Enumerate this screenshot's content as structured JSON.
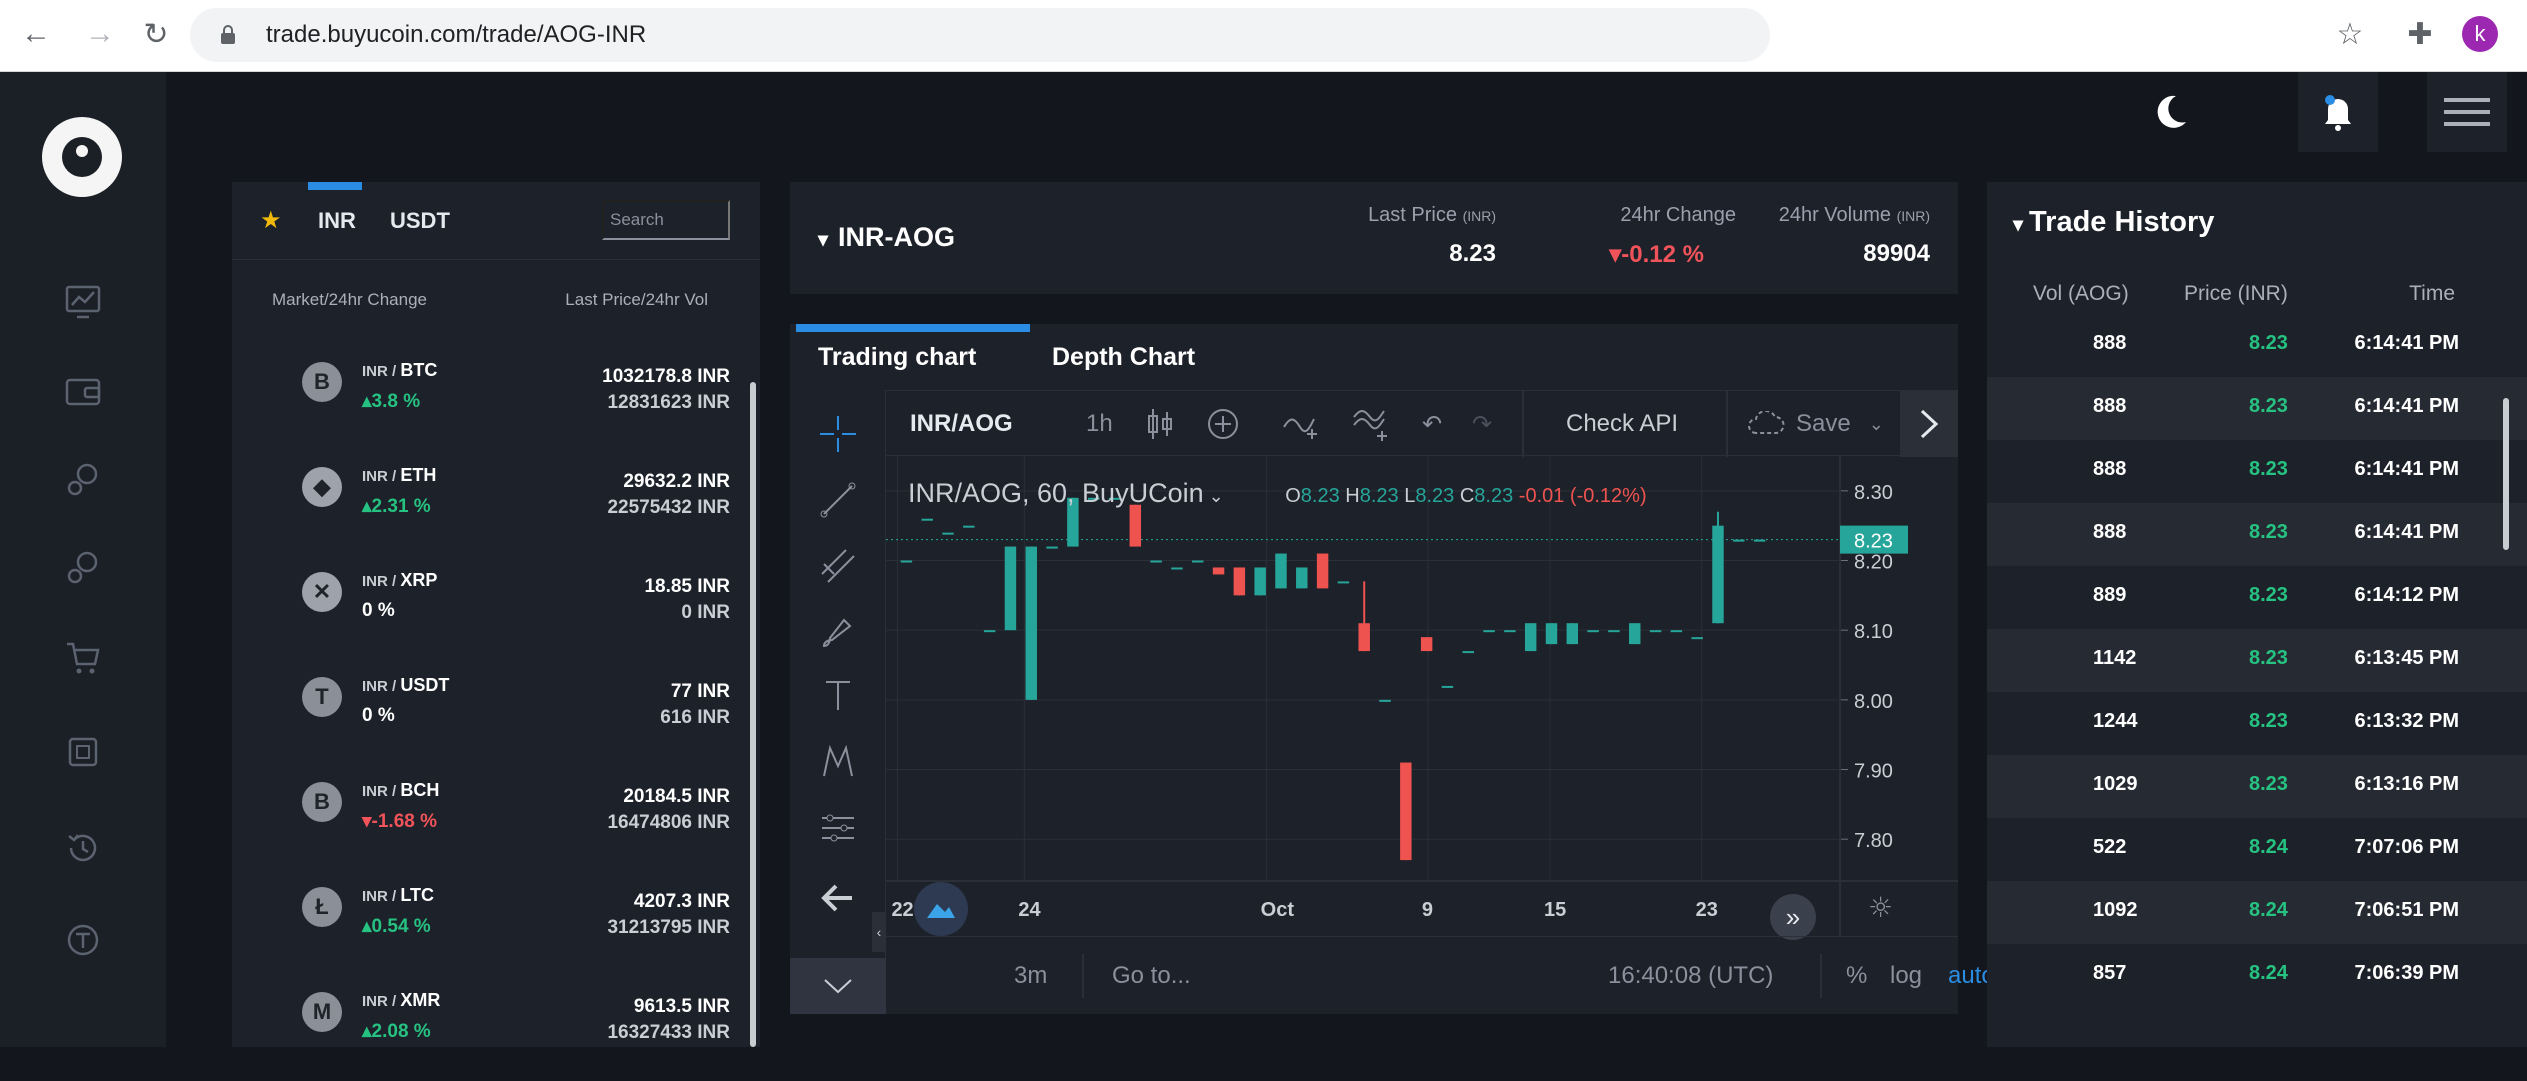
{
  "browser": {
    "url": "trade.buyucoin.com/trade/AOG-INR",
    "avatar_letter": "k"
  },
  "markets": {
    "tabs": [
      "INR",
      "USDT"
    ],
    "search_placeholder": "Search",
    "col_left": "Market/24hr Change",
    "col_right": "Last Price/24hr Vol",
    "rows": [
      {
        "base": "INR",
        "quote": "BTC",
        "change": "▴3.8 %",
        "dir": "up",
        "price": "1032178.8 INR",
        "volume": "12831623 INR",
        "coin_color": "#8a8f98",
        "glyph": "B"
      },
      {
        "base": "INR",
        "quote": "ETH",
        "change": "▴2.31 %",
        "dir": "up",
        "price": "29632.2 INR",
        "volume": "22575432 INR",
        "coin_color": "#9ea3ab",
        "glyph": "◆"
      },
      {
        "base": "INR",
        "quote": "XRP",
        "change": "0 %",
        "dir": "flat",
        "price": "18.85 INR",
        "volume": "0 INR",
        "coin_color": "#9ea3ab",
        "glyph": "✕"
      },
      {
        "base": "INR",
        "quote": "USDT",
        "change": "0 %",
        "dir": "flat",
        "price": "77 INR",
        "volume": "616 INR",
        "coin_color": "#8a8f98",
        "glyph": "T"
      },
      {
        "base": "INR",
        "quote": "BCH",
        "change": "▾-1.68 %",
        "dir": "down",
        "price": "20184.5 INR",
        "volume": "16474806 INR",
        "coin_color": "#8a8f98",
        "glyph": "B"
      },
      {
        "base": "INR",
        "quote": "LTC",
        "change": "▴0.54 %",
        "dir": "up",
        "price": "4207.3 INR",
        "volume": "31213795 INR",
        "coin_color": "#8a8f98",
        "glyph": "Ł"
      },
      {
        "base": "INR",
        "quote": "XMR",
        "change": "▴2.08 %",
        "dir": "up",
        "price": "9613.5 INR",
        "volume": "16327433 INR",
        "coin_color": "#8a8f98",
        "glyph": "M"
      }
    ]
  },
  "ticker": {
    "pair": "INR-AOG",
    "last_price_label": "Last Price",
    "last_price_unit": "(INR)",
    "last_price": "8.23",
    "change_label": "24hr Change",
    "change": "▾-0.12 %",
    "volume_label": "24hr Volume",
    "volume_unit": "(INR)",
    "volume": "89904"
  },
  "chart_tabs": [
    "Trading chart",
    "Depth Chart"
  ],
  "chart_toolbar": {
    "symbol": "INR/AOG",
    "interval": "1h",
    "check_api": "Check API",
    "save": "Save"
  },
  "chart_legend": {
    "title": "INR/AOG, 60, BuyUCoin",
    "o": "8.23",
    "h": "8.23",
    "l": "8.23",
    "c": "8.23",
    "chg": "-0.01 (-0.12%)"
  },
  "chart_bottom": {
    "range": "3m",
    "goto": "Go to...",
    "clock": "16:40:08 (UTC)",
    "pct": "%",
    "log": "log",
    "auto": "auto"
  },
  "colors": {
    "up": "#26a69a",
    "down": "#ef5350",
    "accent": "#2a8de3"
  },
  "chart_data": {
    "type": "candlestick",
    "x_ticks": [
      "22",
      "24",
      "Oct",
      "9",
      "15",
      "23"
    ],
    "y_ticks": [
      "8.30",
      "8.20",
      "8.10",
      "8.00",
      "7.90",
      "7.80"
    ],
    "ylim": [
      7.74,
      8.35
    ],
    "current_price_label": "8.23",
    "candles": [
      {
        "o": 8.2,
        "c": 8.2,
        "h": 8.2,
        "l": 8.2
      },
      {
        "o": 8.26,
        "c": 8.26,
        "h": 8.26,
        "l": 8.26
      },
      {
        "o": 8.24,
        "c": 8.24,
        "h": 8.24,
        "l": 8.24
      },
      {
        "o": 8.25,
        "c": 8.25,
        "h": 8.25,
        "l": 8.25
      },
      {
        "o": 8.1,
        "c": 8.1,
        "h": 8.1,
        "l": 8.1
      },
      {
        "o": 8.1,
        "c": 8.22,
        "h": 8.22,
        "l": 8.1
      },
      {
        "o": 8.0,
        "c": 8.22,
        "h": 8.22,
        "l": 8.0
      },
      {
        "o": 8.22,
        "c": 8.22,
        "h": 8.22,
        "l": 8.22
      },
      {
        "o": 8.22,
        "c": 8.29,
        "h": 8.29,
        "l": 8.22
      },
      {
        "o": 8.29,
        "c": 8.29,
        "h": 8.29,
        "l": 8.29
      },
      {
        "o": 8.29,
        "c": 8.29,
        "h": 8.29,
        "l": 8.29
      },
      {
        "o": 8.28,
        "c": 8.22,
        "h": 8.28,
        "l": 8.22
      },
      {
        "o": 8.2,
        "c": 8.2,
        "h": 8.2,
        "l": 8.2
      },
      {
        "o": 8.19,
        "c": 8.19,
        "h": 8.19,
        "l": 8.19
      },
      {
        "o": 8.2,
        "c": 8.2,
        "h": 8.2,
        "l": 8.2
      },
      {
        "o": 8.19,
        "c": 8.18,
        "h": 8.19,
        "l": 8.18
      },
      {
        "o": 8.19,
        "c": 8.15,
        "h": 8.19,
        "l": 8.15
      },
      {
        "o": 8.15,
        "c": 8.19,
        "h": 8.19,
        "l": 8.15
      },
      {
        "o": 8.16,
        "c": 8.21,
        "h": 8.21,
        "l": 8.16
      },
      {
        "o": 8.16,
        "c": 8.19,
        "h": 8.19,
        "l": 8.16
      },
      {
        "o": 8.21,
        "c": 8.16,
        "h": 8.21,
        "l": 8.16
      },
      {
        "o": 8.17,
        "c": 8.17,
        "h": 8.17,
        "l": 8.17
      },
      {
        "o": 8.11,
        "c": 8.07,
        "h": 8.17,
        "l": 8.07
      },
      {
        "o": 8.0,
        "c": 8.0,
        "h": 8.0,
        "l": 8.0
      },
      {
        "o": 7.91,
        "c": 7.77,
        "h": 7.91,
        "l": 7.77
      },
      {
        "o": 8.09,
        "c": 8.07,
        "h": 8.09,
        "l": 8.07
      },
      {
        "o": 8.02,
        "c": 8.02,
        "h": 8.02,
        "l": 8.02
      },
      {
        "o": 8.07,
        "c": 8.07,
        "h": 8.07,
        "l": 8.07
      },
      {
        "o": 8.1,
        "c": 8.1,
        "h": 8.1,
        "l": 8.1
      },
      {
        "o": 8.1,
        "c": 8.1,
        "h": 8.1,
        "l": 8.1
      },
      {
        "o": 8.07,
        "c": 8.11,
        "h": 8.11,
        "l": 8.07
      },
      {
        "o": 8.08,
        "c": 8.11,
        "h": 8.11,
        "l": 8.08
      },
      {
        "o": 8.08,
        "c": 8.11,
        "h": 8.11,
        "l": 8.08
      },
      {
        "o": 8.1,
        "c": 8.1,
        "h": 8.1,
        "l": 8.1
      },
      {
        "o": 8.1,
        "c": 8.1,
        "h": 8.1,
        "l": 8.1
      },
      {
        "o": 8.08,
        "c": 8.11,
        "h": 8.11,
        "l": 8.08
      },
      {
        "o": 8.1,
        "c": 8.1,
        "h": 8.1,
        "l": 8.1
      },
      {
        "o": 8.1,
        "c": 8.1,
        "h": 8.1,
        "l": 8.1
      },
      {
        "o": 8.09,
        "c": 8.09,
        "h": 8.09,
        "l": 8.09
      },
      {
        "o": 8.11,
        "c": 8.25,
        "h": 8.27,
        "l": 8.11
      },
      {
        "o": 8.23,
        "c": 8.23,
        "h": 8.23,
        "l": 8.23
      },
      {
        "o": 8.23,
        "c": 8.23,
        "h": 8.23,
        "l": 8.23
      }
    ]
  },
  "history": {
    "title": "Trade History",
    "headers": [
      "Vol (AOG)",
      "Price (INR)",
      "Time"
    ],
    "rows": [
      {
        "vol": "888",
        "price": "8.23",
        "time": "6:14:41 PM"
      },
      {
        "vol": "888",
        "price": "8.23",
        "time": "6:14:41 PM"
      },
      {
        "vol": "888",
        "price": "8.23",
        "time": "6:14:41 PM"
      },
      {
        "vol": "888",
        "price": "8.23",
        "time": "6:14:41 PM"
      },
      {
        "vol": "889",
        "price": "8.23",
        "time": "6:14:12 PM"
      },
      {
        "vol": "1142",
        "price": "8.23",
        "time": "6:13:45 PM"
      },
      {
        "vol": "1244",
        "price": "8.23",
        "time": "6:13:32 PM"
      },
      {
        "vol": "1029",
        "price": "8.23",
        "time": "6:13:16 PM"
      },
      {
        "vol": "522",
        "price": "8.24",
        "time": "7:07:06 PM"
      },
      {
        "vol": "1092",
        "price": "8.24",
        "time": "7:06:51 PM"
      },
      {
        "vol": "857",
        "price": "8.24",
        "time": "7:06:39 PM"
      }
    ]
  }
}
